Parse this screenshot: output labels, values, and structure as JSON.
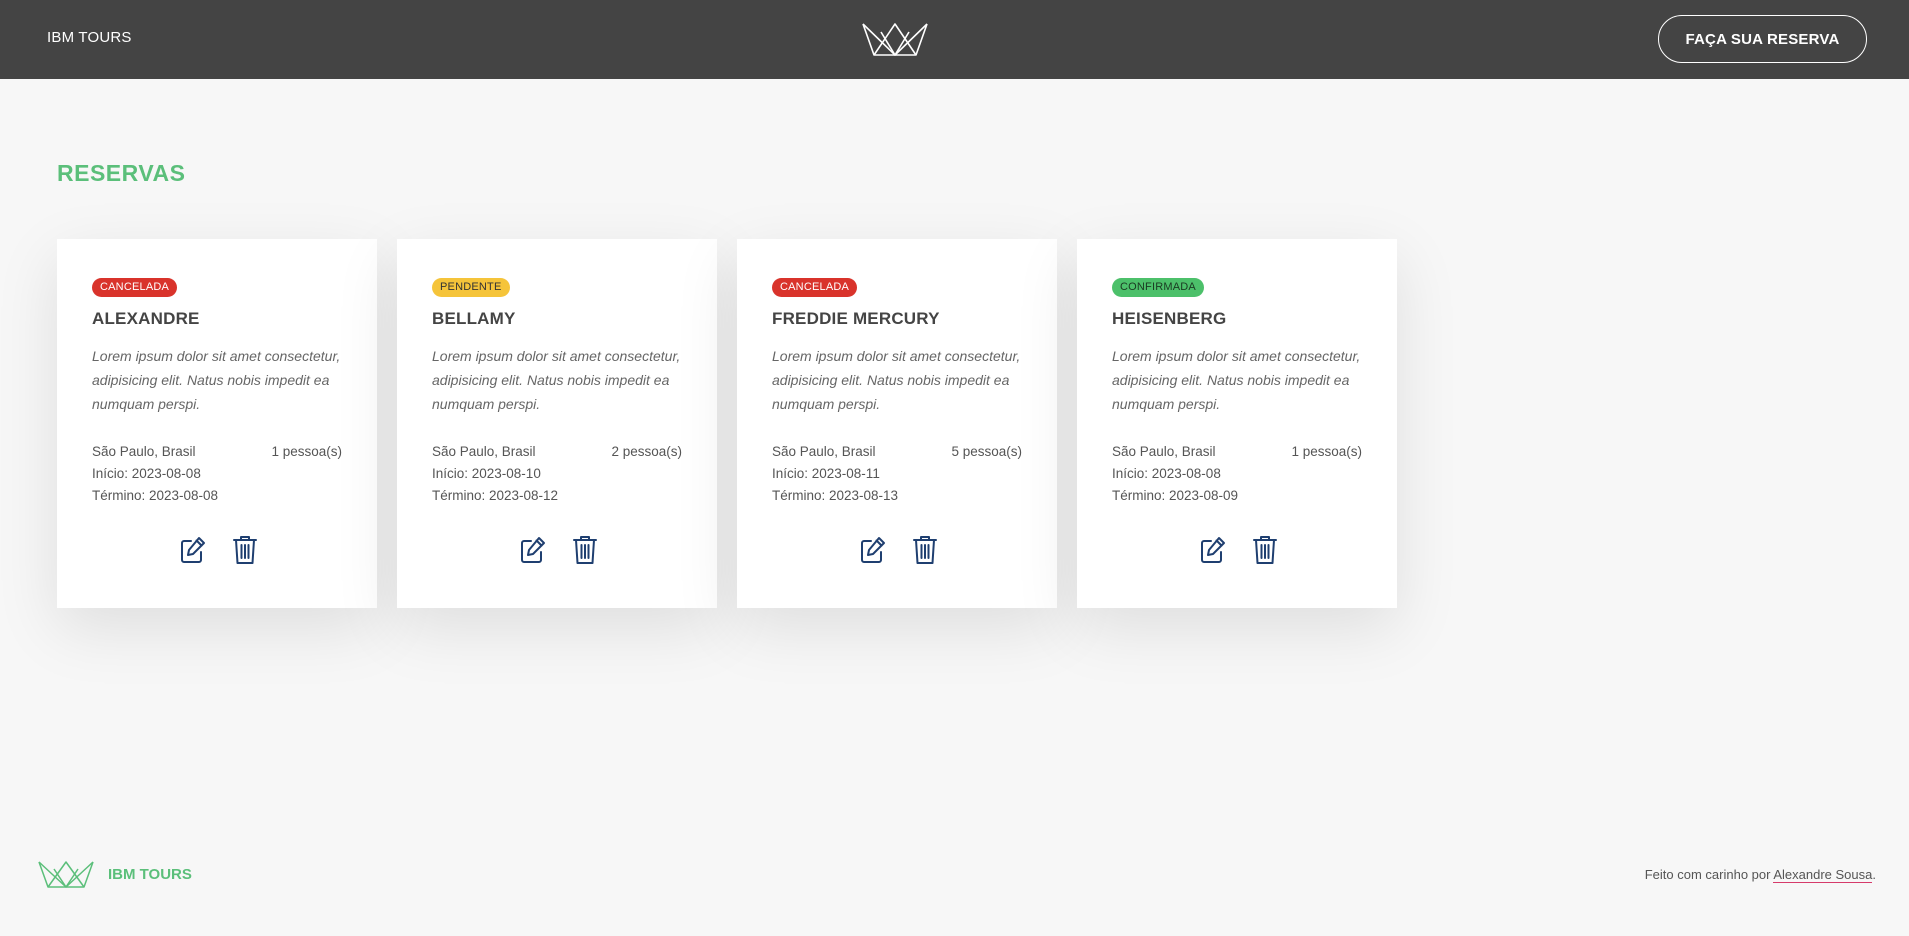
{
  "header": {
    "brand": "IBM TOURS",
    "logo_icon": "crown-icon",
    "cta_label": "FAÇA SUA RESERVA"
  },
  "main": {
    "title": "RESERVAS",
    "cards": [
      {
        "status": "CANCELADA",
        "status_color": "#d9332b",
        "name": "ALEXANDRE",
        "description": "Lorem ipsum dolor sit amet consectetur, adipisicing elit. Natus nobis impedit ea numquam perspi.",
        "location": "São Paulo, Brasil",
        "people": "1 pessoa(s)",
        "start": "Início: 2023-08-08",
        "end": "Término: 2023-08-08"
      },
      {
        "status": "PENDENTE",
        "status_color": "#f5c43a",
        "name": "BELLAMY",
        "description": "Lorem ipsum dolor sit amet consectetur, adipisicing elit. Natus nobis impedit ea numquam perspi.",
        "location": "São Paulo, Brasil",
        "people": "2 pessoa(s)",
        "start": "Início: 2023-08-10",
        "end": "Término: 2023-08-12"
      },
      {
        "status": "CANCELADA",
        "status_color": "#d9332b",
        "name": "FREDDIE MERCURY",
        "description": "Lorem ipsum dolor sit amet consectetur, adipisicing elit. Natus nobis impedit ea numquam perspi.",
        "location": "São Paulo, Brasil",
        "people": "5 pessoa(s)",
        "start": "Início: 2023-08-11",
        "end": "Término: 2023-08-13"
      },
      {
        "status": "CONFIRMADA",
        "status_color": "#4cc06a",
        "name": "HEISENBERG",
        "description": "Lorem ipsum dolor sit amet consectetur, adipisicing elit. Natus nobis impedit ea numquam perspi.",
        "location": "São Paulo, Brasil",
        "people": "1 pessoa(s)",
        "start": "Início: 2023-08-08",
        "end": "Término: 2023-08-09"
      }
    ],
    "action_icons": [
      "edit-icon",
      "trash-icon"
    ]
  },
  "footer": {
    "logo_icon": "crown-icon",
    "brand": "IBM TOURS",
    "credit_prefix": "Feito com carinho por ",
    "credit_author": "Alexandre Sousa",
    "credit_suffix": "."
  },
  "colors": {
    "header_bg": "#444444",
    "accent_green": "#5bbf7a",
    "icon_blue": "#1f3f70",
    "page_bg": "#f7f7f7"
  }
}
